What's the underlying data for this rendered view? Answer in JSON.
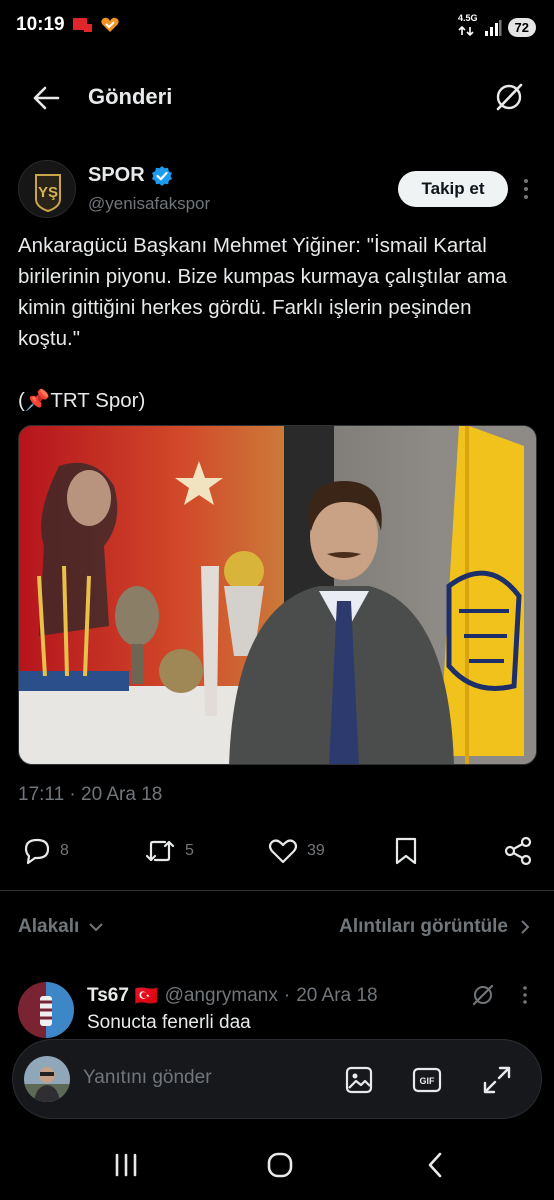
{
  "status_bar": {
    "time": "10:19",
    "network": "4.5G",
    "battery": "72"
  },
  "header": {
    "title": "Gönderi"
  },
  "tweet": {
    "author_name": "SPOR",
    "author_handle": "@yenisafakspor",
    "avatar_text": "YŞ",
    "follow_label": "Takip et",
    "text": "Ankaragücü Başkanı Mehmet Yiğiner: \"İsmail Kartal birilerinin piyonu. Bize kumpas kurmaya çalıştılar ama kimin gittiğini herkes gördü. Farklı işlerin peşinden koştu.\"\n\n(📌TRT Spor)",
    "timestamp": "17:11 · 20 Ara 18",
    "replies": "8",
    "retweets": "5",
    "likes": "39"
  },
  "related": {
    "label": "Alakalı",
    "quotes_label": "Alıntıları görüntüle"
  },
  "reply": {
    "name": "Ts67",
    "flag": "🇹🇷",
    "handle": "@angrymanx",
    "date": "20 Ara 18",
    "text": "Sonucta fenerli daa"
  },
  "compose": {
    "placeholder": "Yanıtını gönder"
  },
  "colors": {
    "background": "#000000",
    "text_primary": "#e7e9ea",
    "text_secondary": "#71767b",
    "verified": "#1d9bf0",
    "follow_button_bg": "#eff3f4"
  }
}
